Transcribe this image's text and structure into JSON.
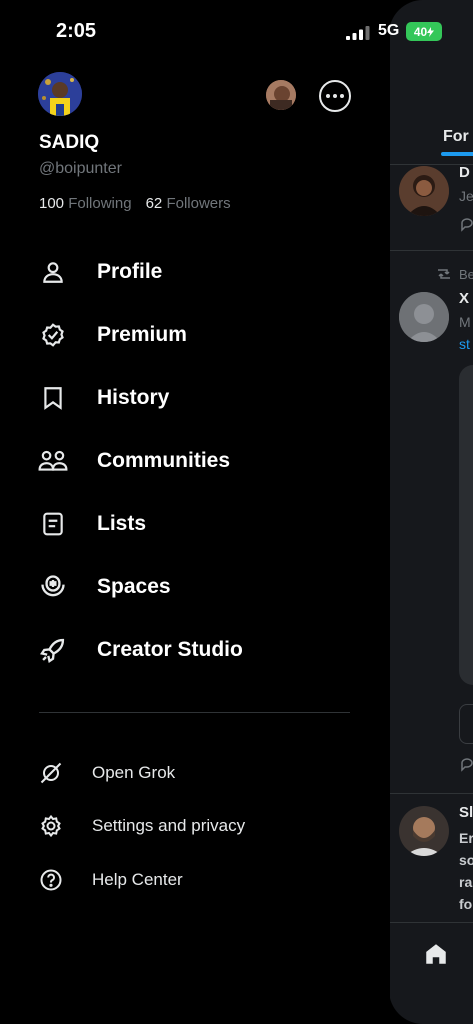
{
  "status": {
    "time": "2:05",
    "network": "5G",
    "battery": "40"
  },
  "profile": {
    "name": "SADIQ",
    "handle": "@boipunter",
    "following_count": "100",
    "following_label": "Following",
    "followers_count": "62",
    "followers_label": "Followers"
  },
  "menu": {
    "items": [
      {
        "label": "Profile",
        "icon": "person-icon"
      },
      {
        "label": "Premium",
        "icon": "verified-badge-icon"
      },
      {
        "label": "History",
        "icon": "bookmark-icon"
      },
      {
        "label": "Communities",
        "icon": "people-icon"
      },
      {
        "label": "Lists",
        "icon": "list-icon"
      },
      {
        "label": "Spaces",
        "icon": "microphone-icon"
      },
      {
        "label": "Creator Studio",
        "icon": "rocket-icon"
      }
    ]
  },
  "secondary": {
    "items": [
      {
        "label": "Open Grok",
        "icon": "grok-icon"
      },
      {
        "label": "Settings and privacy",
        "icon": "gear-icon"
      },
      {
        "label": "Help Center",
        "icon": "help-icon"
      }
    ]
  },
  "behind": {
    "tab_label": "For",
    "post1": {
      "name": "D",
      "text": "Je"
    },
    "post2": {
      "repost": "Be",
      "name": "X",
      "text": "M",
      "link": "st"
    },
    "post3": {
      "name": "Sl",
      "lines": [
        "Er",
        "so",
        "ra",
        "fo"
      ]
    }
  },
  "colors": {
    "background": "#000000",
    "accent": "#1d9bf0",
    "muted": "#71767b",
    "battery": "#34c759"
  }
}
